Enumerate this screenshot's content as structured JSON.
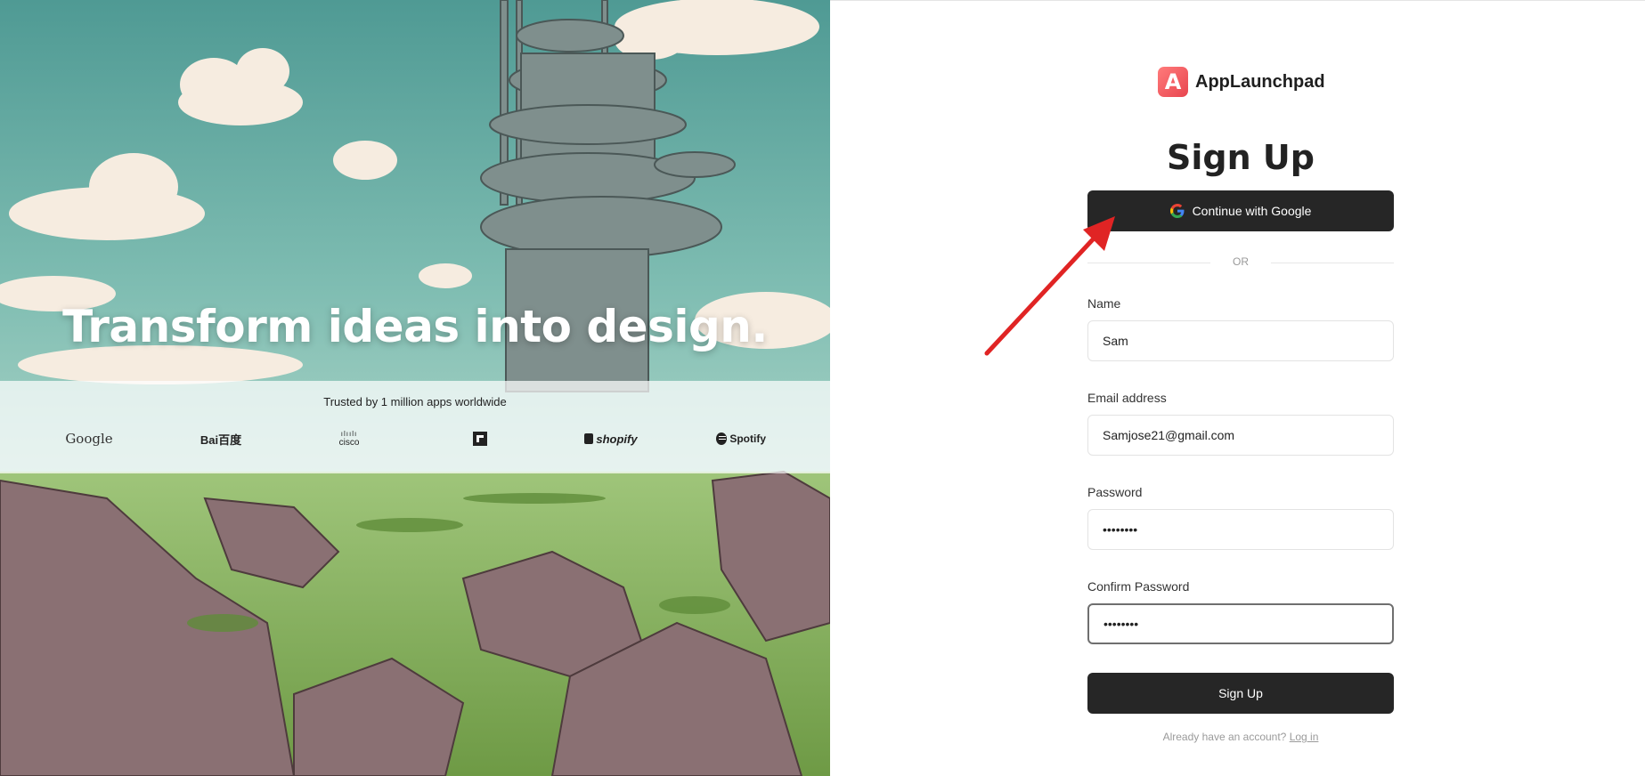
{
  "hero": {
    "title": "Transform ideas into design.",
    "trusted_text": "Trusted by 1 million apps worldwide",
    "logos": [
      {
        "name": "Google",
        "label": "Google"
      },
      {
        "name": "Baidu",
        "label": "Bai百度"
      },
      {
        "name": "Cisco",
        "label": "cisco"
      },
      {
        "name": "Flipboard",
        "label": ""
      },
      {
        "name": "Shopify",
        "label": "shopify"
      },
      {
        "name": "Spotify",
        "label": "Spotify"
      }
    ]
  },
  "brand": {
    "mark": "A",
    "name": "AppLaunchpad"
  },
  "form": {
    "heading": "Sign Up",
    "google_button": "Continue with Google",
    "divider": "OR",
    "fields": {
      "name": {
        "label": "Name",
        "value": "Sam"
      },
      "email": {
        "label": "Email address",
        "value": "Samjose21@gmail.com"
      },
      "password": {
        "label": "Password",
        "value": "••••••••"
      },
      "confirm_password": {
        "label": "Confirm Password",
        "value": "••••••••"
      }
    },
    "submit_button": "Sign Up",
    "login_prompt": "Already have an account?",
    "login_link": "Log in"
  },
  "colors": {
    "button_dark": "#262626",
    "brand_accent": "#e8454f",
    "annotation_arrow": "#e02424"
  }
}
